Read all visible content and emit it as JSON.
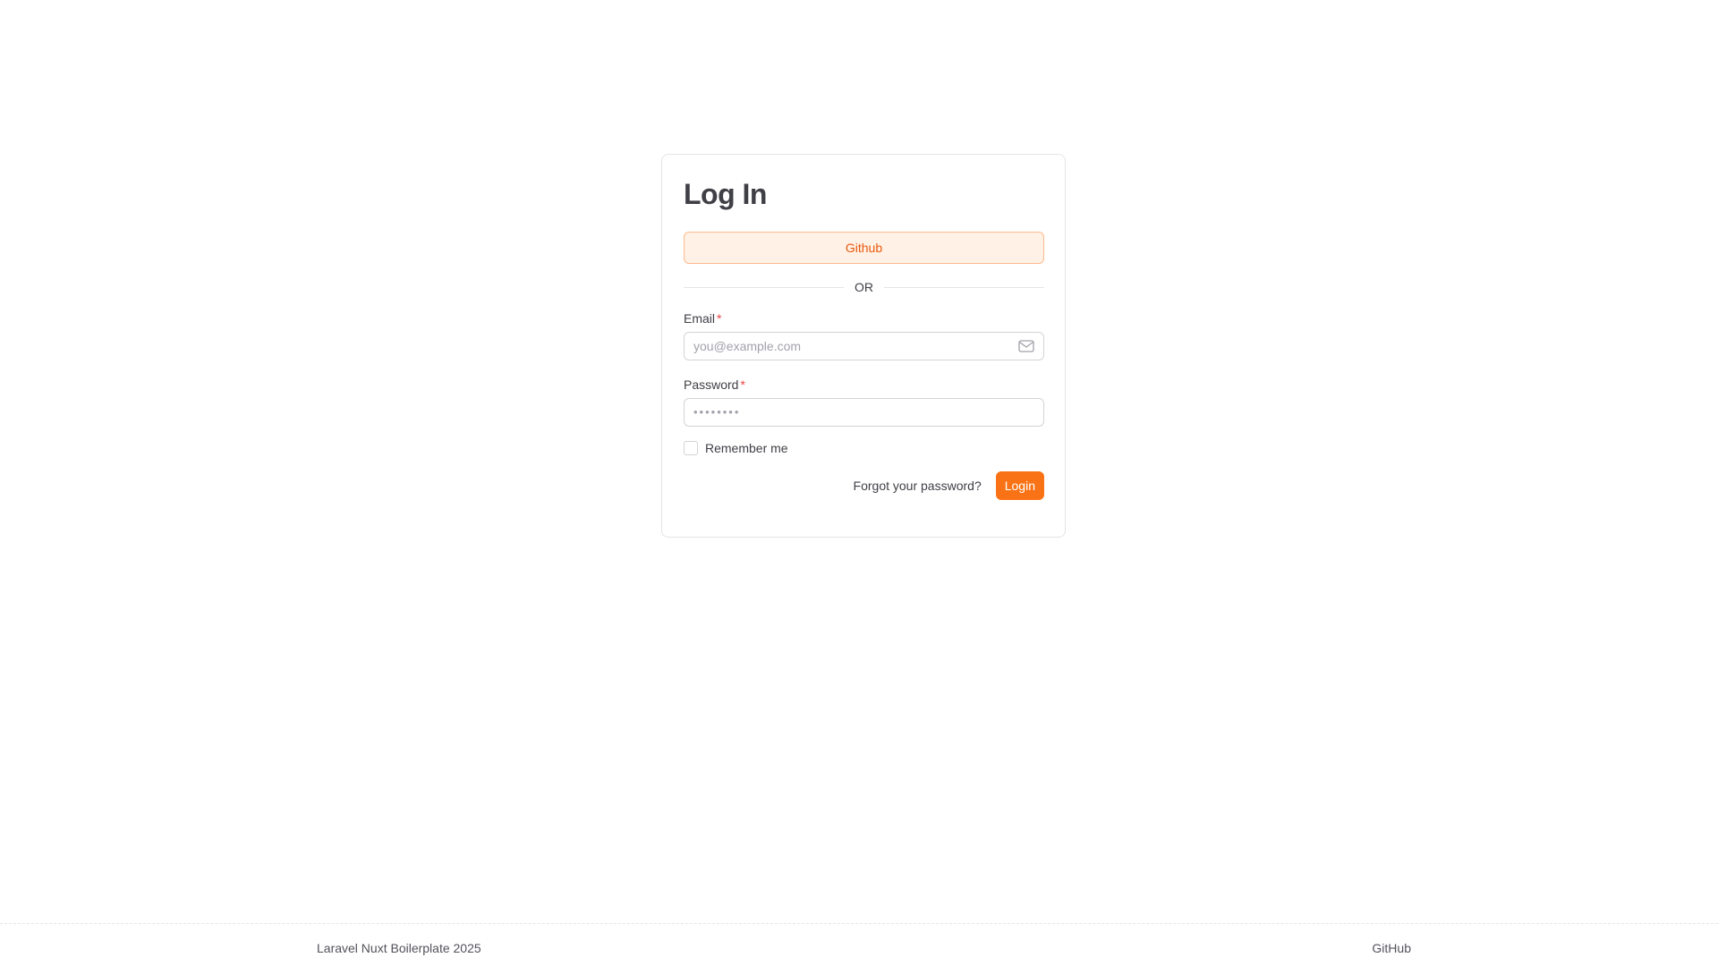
{
  "login": {
    "title": "Log In",
    "oauth_github_label": "Github",
    "divider_text": "OR",
    "email": {
      "label": "Email",
      "required_mark": "*",
      "placeholder": "you@example.com",
      "value": ""
    },
    "password": {
      "label": "Password",
      "required_mark": "*",
      "masked_value": "••••••••"
    },
    "remember_me_label": "Remember me",
    "remember_me_checked": false,
    "forgot_password_label": "Forgot your password?",
    "submit_label": "Login"
  },
  "footer": {
    "copyright": "Laravel Nuxt Boilerplate 2025",
    "github_link": "GitHub"
  },
  "colors": {
    "accent": "#f97316",
    "accent_text": "#ea580c",
    "accent_soft_bg": "#fff1e6",
    "required": "#ef4444"
  },
  "icons": {
    "email_field_icon": "mail-icon"
  }
}
